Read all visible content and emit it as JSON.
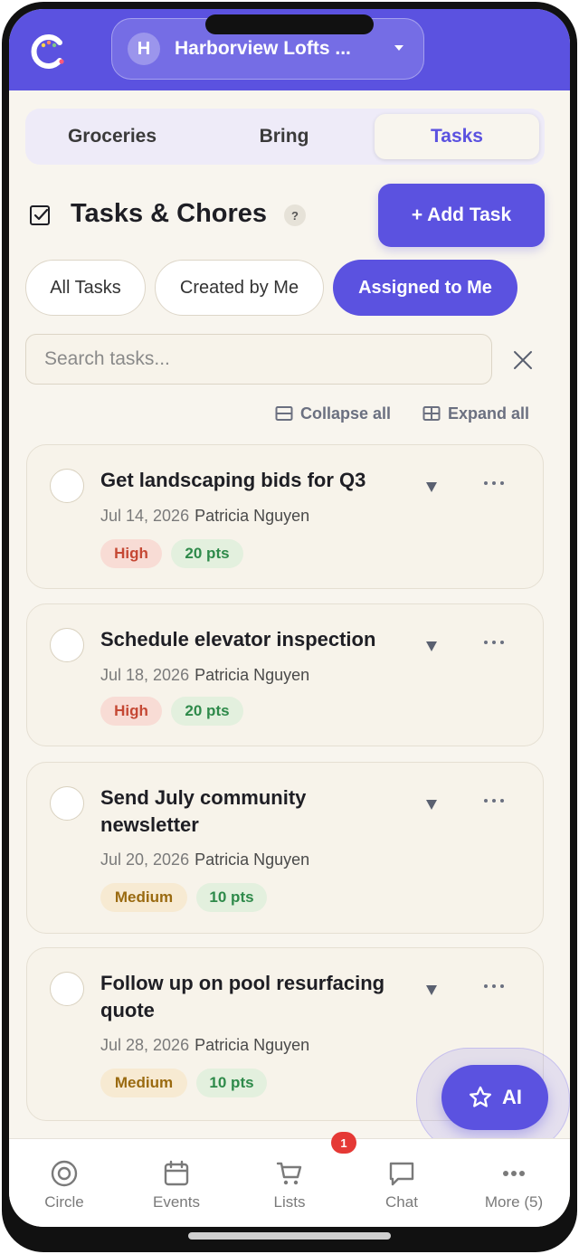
{
  "header": {
    "property_initial": "H",
    "property_name": "Harborview Lofts ..."
  },
  "tabs": [
    {
      "label": "Groceries",
      "active": false
    },
    {
      "label": "Bring",
      "active": false
    },
    {
      "label": "Tasks",
      "active": true
    }
  ],
  "page": {
    "title": "Tasks & Chores",
    "help": "?",
    "add_button": "+ Add Task"
  },
  "filters": [
    {
      "label": "All Tasks",
      "active": false
    },
    {
      "label": "Created by Me",
      "active": false
    },
    {
      "label": "Assigned to Me",
      "active": true
    }
  ],
  "search": {
    "placeholder": "Search tasks...",
    "value": ""
  },
  "tools": {
    "collapse_all": "Collapse all",
    "expand_all": "Expand all"
  },
  "tasks": [
    {
      "title": "Get landscaping bids for Q3",
      "date": "Jul 14, 2026",
      "assignee": "Patricia Nguyen",
      "priority": "High",
      "points": "20 pts"
    },
    {
      "title": "Schedule elevator inspection",
      "date": "Jul 18, 2026",
      "assignee": "Patricia Nguyen",
      "priority": "High",
      "points": "20 pts"
    },
    {
      "title": "Send July community newsletter",
      "date": "Jul 20, 2026",
      "assignee": "Patricia Nguyen",
      "priority": "Medium",
      "points": "10 pts"
    },
    {
      "title": "Follow up on pool resurfacing quote",
      "date": "Jul 28, 2026",
      "assignee": "Patricia Nguyen",
      "priority": "Medium",
      "points": "10 pts"
    }
  ],
  "ai_button": "AI",
  "bottom_nav": {
    "items": [
      {
        "label": "Circle",
        "icon": "circle-icon"
      },
      {
        "label": "Events",
        "icon": "calendar-icon"
      },
      {
        "label": "Lists",
        "icon": "cart-icon"
      },
      {
        "label": "Chat",
        "icon": "chat-icon"
      },
      {
        "label": "More (5)",
        "icon": "more-icon"
      }
    ],
    "lists_badge": "1"
  },
  "colors": {
    "accent": "#5b52e0",
    "background": "#f8f5ee",
    "high": "#c54834",
    "medium": "#9a6a10",
    "points": "#2e8a4a",
    "badge_red": "#e53935"
  }
}
